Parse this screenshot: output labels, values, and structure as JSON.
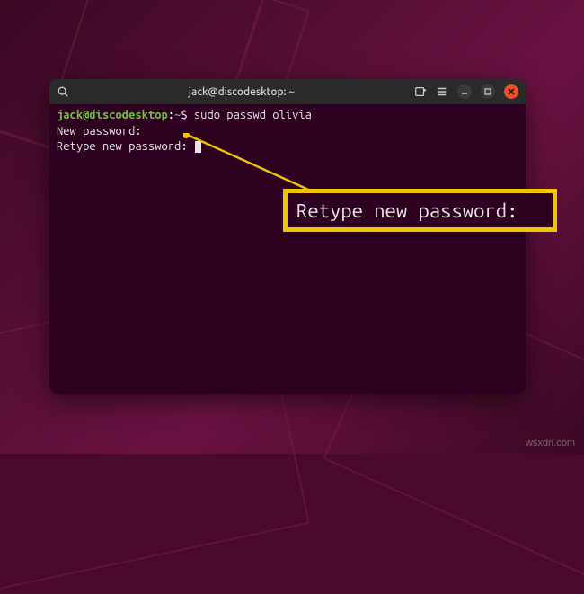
{
  "window": {
    "title": "jack@discodesktop: ~"
  },
  "prompt": {
    "user_host": "jack@discodesktop",
    "separator": ":",
    "path": "~",
    "symbol": "$"
  },
  "terminal": {
    "command": "sudo passwd olivia",
    "line2": "New password:",
    "line3": "Retype new password:"
  },
  "callout": {
    "text": "Retype new password:"
  },
  "watermark": "wsxdn.com"
}
